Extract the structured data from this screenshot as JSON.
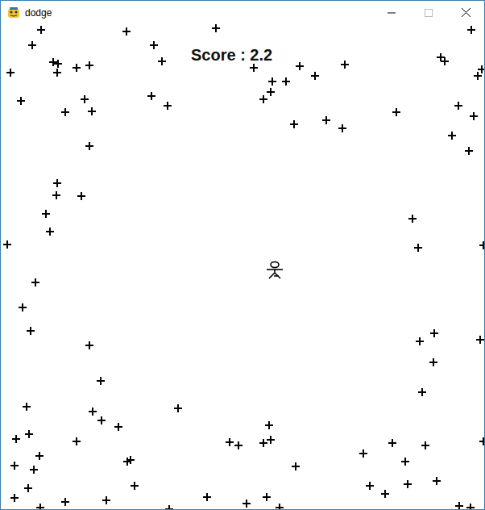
{
  "window": {
    "title": "dodge"
  },
  "score": "Score : 2.2"
}
